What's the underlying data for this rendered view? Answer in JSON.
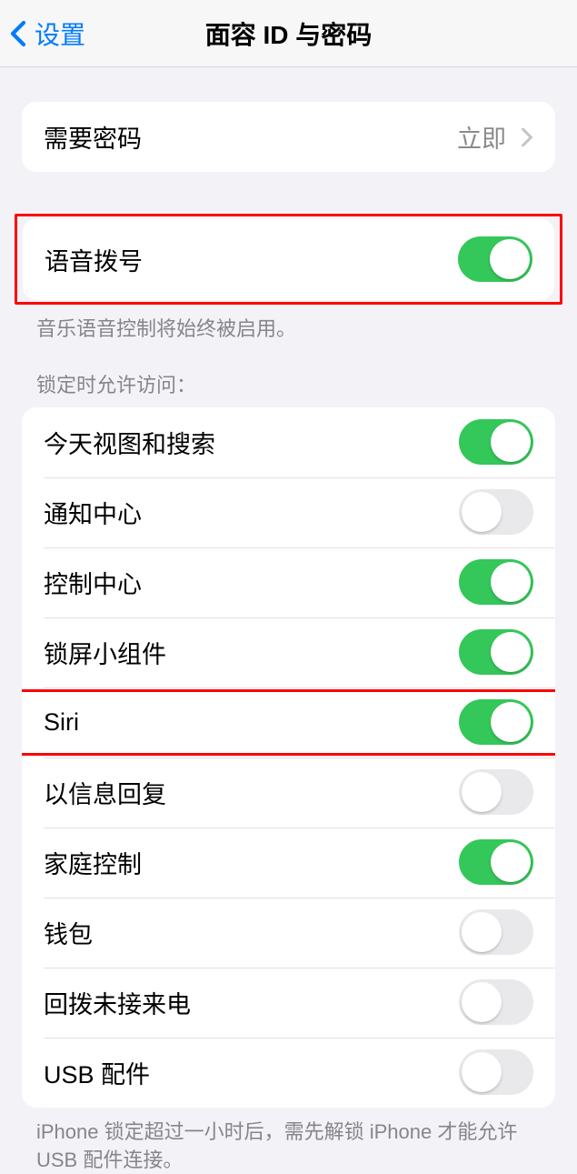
{
  "nav": {
    "back": "设置",
    "title": "面容 ID 与密码"
  },
  "require_passcode": {
    "label": "需要密码",
    "value": "立即"
  },
  "voice_dial": {
    "label": "语音拨号",
    "footer": "音乐语音控制将始终被启用。"
  },
  "lock_access_header": "锁定时允许访问：",
  "lock_items": {
    "today": "今天视图和搜索",
    "notifications": "通知中心",
    "control": "控制中心",
    "widgets": "锁屏小组件",
    "siri": "Siri",
    "reply": "以信息回复",
    "home": "家庭控制",
    "wallet": "钱包",
    "callback": "回拨未接来电",
    "usb": "USB 配件"
  },
  "usb_footer": "iPhone 锁定超过一小时后，需先解锁 iPhone 才能允许 USB 配件连接。"
}
